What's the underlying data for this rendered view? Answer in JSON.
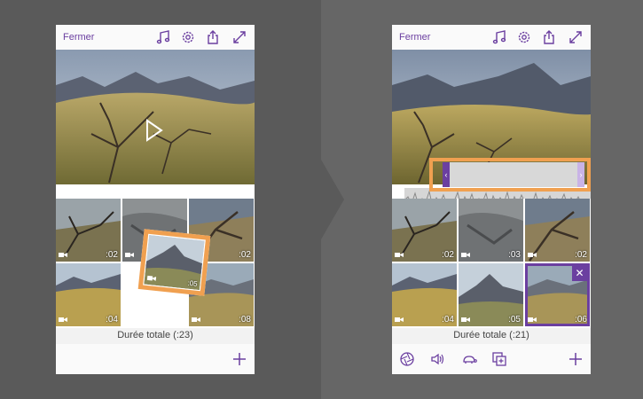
{
  "left_screen": {
    "close_label": "Fermer",
    "total_label": "Durée totale (:23)",
    "clips": [
      {
        "duration": ":02"
      },
      {
        "duration": ""
      },
      {
        "duration": ":02"
      },
      {
        "duration": ":04"
      },
      {
        "duration": ":08"
      }
    ],
    "dragged_clip": {
      "duration": ":05"
    }
  },
  "right_screen": {
    "close_label": "Fermer",
    "total_label": "Durée totale (:21)",
    "clips": [
      {
        "duration": ":02"
      },
      {
        "duration": ":03"
      },
      {
        "duration": ":02"
      },
      {
        "duration": ":04"
      },
      {
        "duration": ":05"
      },
      {
        "duration": ":06"
      }
    ],
    "trim_left": "‹",
    "trim_right": "›",
    "delete_label": "✕"
  },
  "icons": {
    "music": "music-note-icon",
    "settings": "gear-icon",
    "share": "share-icon",
    "fullscreen": "expand-icon",
    "add": "plus-icon",
    "filter": "aperture-icon",
    "volume": "speaker-icon",
    "speed": "turtle-icon",
    "duplicate": "duplicate-icon"
  },
  "colors": {
    "accent": "#6b3fa0",
    "highlight": "#f0a050"
  }
}
